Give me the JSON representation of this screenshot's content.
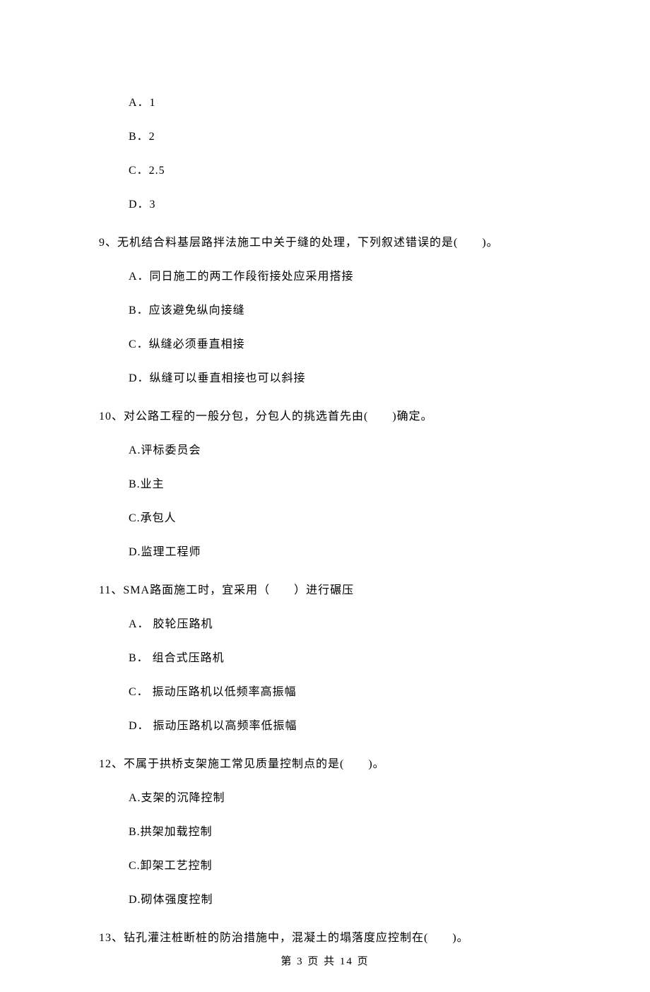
{
  "q_prev_options": {
    "a": "A．1",
    "b": "B．2",
    "c": "C．2.5",
    "d": "D．3"
  },
  "q9": {
    "stem": "9、无机结合料基层路拌法施工中关于缝的处理，下列叙述错误的是(　　)。",
    "a": "A．同日施工的两工作段衔接处应采用搭接",
    "b": "B．应该避免纵向接缝",
    "c": "C．纵缝必须垂直相接",
    "d": "D．纵缝可以垂直相接也可以斜接"
  },
  "q10": {
    "stem": "10、对公路工程的一般分包，分包人的挑选首先由(　　)确定。",
    "a": "A.评标委员会",
    "b": "B.业主",
    "c": "C.承包人",
    "d": "D.监理工程师"
  },
  "q11": {
    "stem": "11、SMA路面施工时，宜采用（　　）进行碾压",
    "a": "A． 胶轮压路机",
    "b": "B． 组合式压路机",
    "c": "C． 振动压路机以低频率高振幅",
    "d": "D． 振动压路机以高频率低振幅"
  },
  "q12": {
    "stem": "12、不属于拱桥支架施工常见质量控制点的是(　　)。",
    "a": "A.支架的沉降控制",
    "b": "B.拱架加载控制",
    "c": "C.卸架工艺控制",
    "d": "D.砌体强度控制"
  },
  "q13": {
    "stem": "13、钻孔灌注桩断桩的防治措施中，混凝土的塌落度应控制在(　　)。"
  },
  "footer": "第 3 页 共 14 页"
}
